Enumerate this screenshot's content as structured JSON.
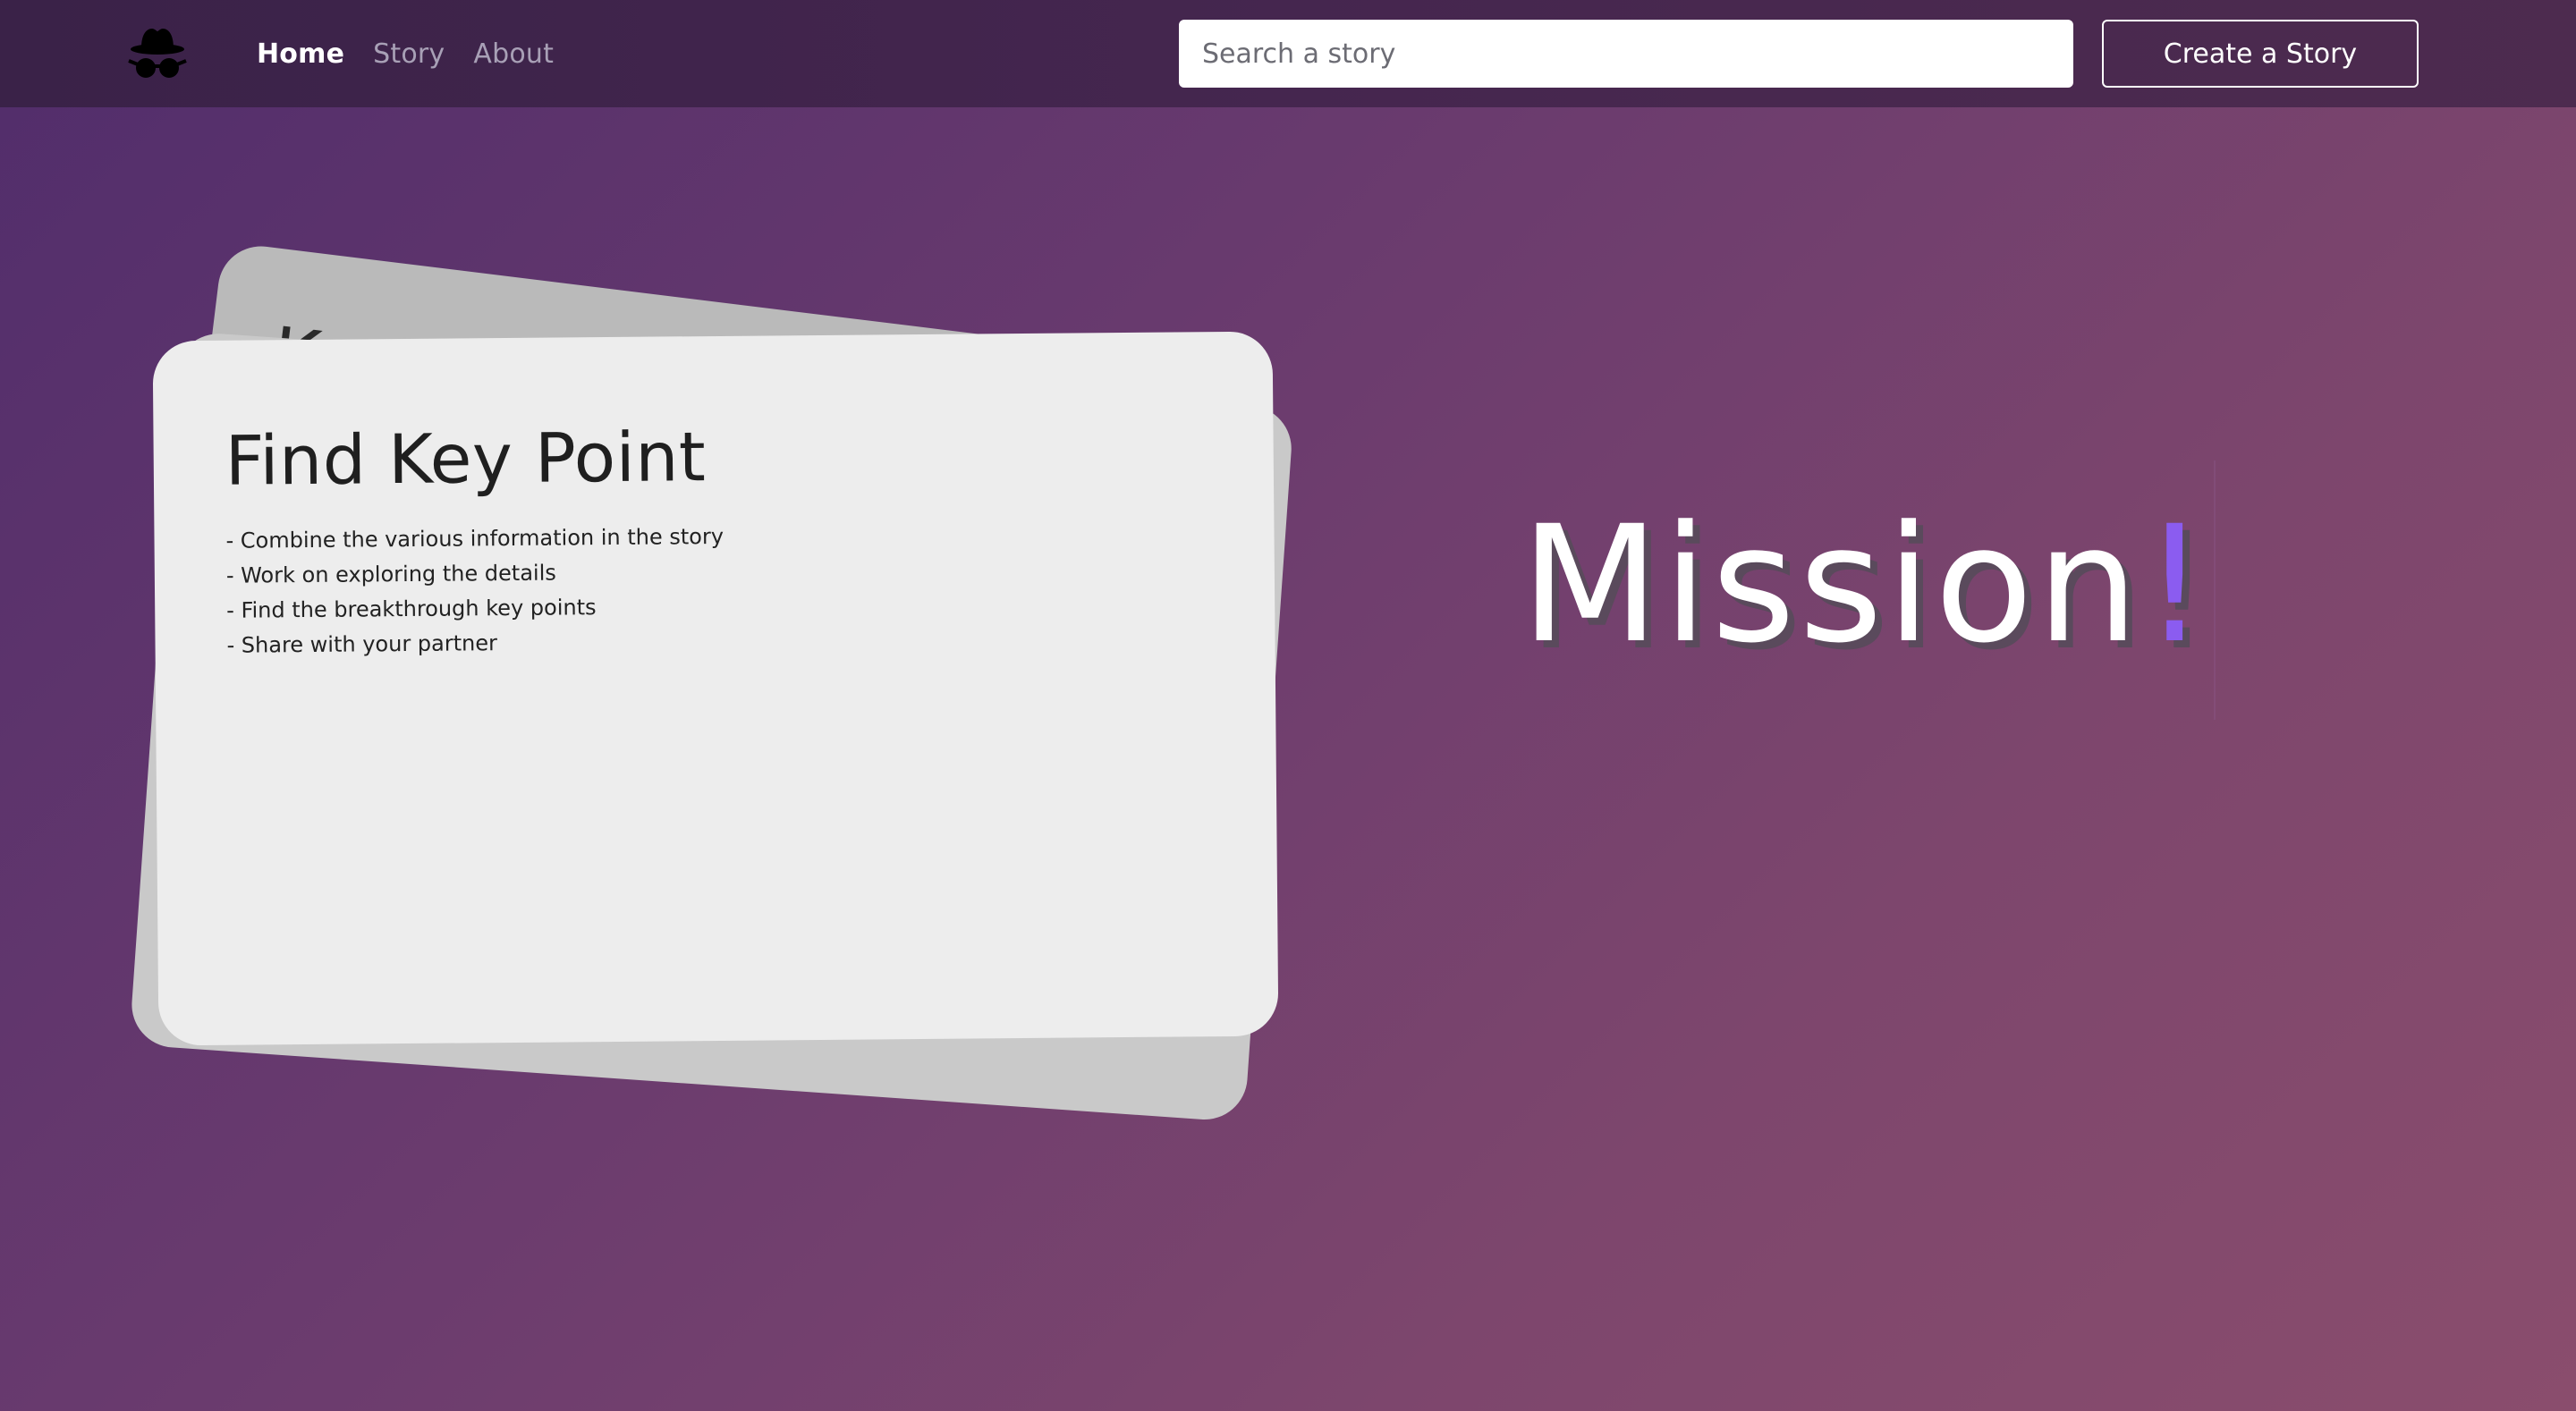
{
  "navbar": {
    "logo_icon": "spy-incognito-icon",
    "links": [
      {
        "label": "Home",
        "active": true
      },
      {
        "label": "Story",
        "active": false
      },
      {
        "label": "About",
        "active": false
      }
    ],
    "search": {
      "placeholder": "Search a story",
      "value": ""
    },
    "create_button_label": "Create a Story"
  },
  "cards": {
    "back_title_peek": "Knowledge",
    "front": {
      "title": "Find Key Point",
      "items": [
        "- Combine the various information in the story",
        "- Work on exploring the details",
        "- Find the breakthrough key points",
        "- Share with your partner"
      ]
    }
  },
  "hero": {
    "word": "Mission",
    "exclaim": "!",
    "accent_color": "#8b5cf0"
  },
  "colors": {
    "navbar_bg": "#3f2450",
    "card_front": "#ededed",
    "card_back": "#bababa"
  }
}
